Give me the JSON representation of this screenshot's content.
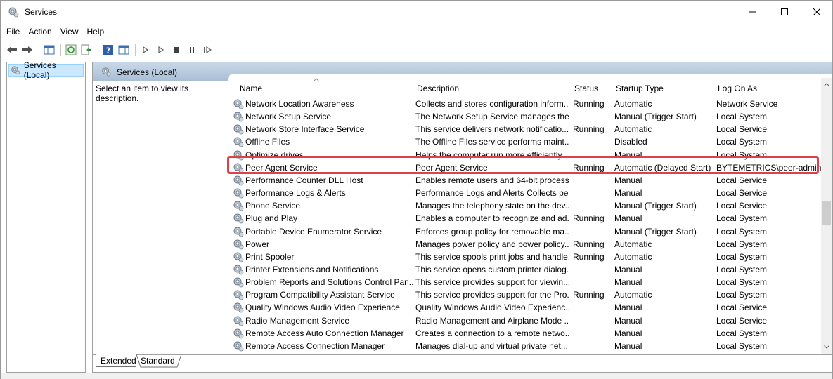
{
  "window": {
    "title": "Services"
  },
  "menu": [
    "File",
    "Action",
    "View",
    "Help"
  ],
  "tree": {
    "selected": "Services (Local)"
  },
  "pane": {
    "title": "Services (Local)",
    "prompt": "Select an item to view its description."
  },
  "columns": {
    "name": "Name",
    "description": "Description",
    "status": "Status",
    "startup": "Startup Type",
    "logon": "Log On As"
  },
  "rows": [
    {
      "name": "Network Location Awareness",
      "description": "Collects and stores configuration inform...",
      "status": "Running",
      "startup": "Automatic",
      "logon": "Network Service"
    },
    {
      "name": "Network Setup Service",
      "description": "The Network Setup Service manages the...",
      "status": "",
      "startup": "Manual (Trigger Start)",
      "logon": "Local System"
    },
    {
      "name": "Network Store Interface Service",
      "description": "This service delivers network notificatio...",
      "status": "Running",
      "startup": "Automatic",
      "logon": "Local Service"
    },
    {
      "name": "Offline Files",
      "description": "The Offline Files service performs maint...",
      "status": "",
      "startup": "Disabled",
      "logon": "Local System"
    },
    {
      "name": "Optimize drives",
      "description": "Helps the computer run more efficiently...",
      "status": "",
      "startup": "Manual",
      "logon": "Local System"
    },
    {
      "name": "Peer Agent Service",
      "description": "Peer Agent Service",
      "status": "Running",
      "startup": "Automatic (Delayed Start)",
      "logon": "BYTEMETRICS\\peer-admin"
    },
    {
      "name": "Performance Counter DLL Host",
      "description": "Enables remote users and 64-bit process...",
      "status": "",
      "startup": "Manual",
      "logon": "Local Service"
    },
    {
      "name": "Performance Logs & Alerts",
      "description": "Performance Logs and Alerts Collects pe...",
      "status": "",
      "startup": "Manual",
      "logon": "Local Service"
    },
    {
      "name": "Phone Service",
      "description": "Manages the telephony state on the dev...",
      "status": "",
      "startup": "Manual (Trigger Start)",
      "logon": "Local Service"
    },
    {
      "name": "Plug and Play",
      "description": "Enables a computer to recognize and ad...",
      "status": "Running",
      "startup": "Manual",
      "logon": "Local System"
    },
    {
      "name": "Portable Device Enumerator Service",
      "description": "Enforces group policy for removable ma...",
      "status": "",
      "startup": "Manual (Trigger Start)",
      "logon": "Local System"
    },
    {
      "name": "Power",
      "description": "Manages power policy and power policy...",
      "status": "Running",
      "startup": "Automatic",
      "logon": "Local System"
    },
    {
      "name": "Print Spooler",
      "description": "This service spools print jobs and handle...",
      "status": "Running",
      "startup": "Automatic",
      "logon": "Local System"
    },
    {
      "name": "Printer Extensions and Notifications",
      "description": "This service opens custom printer dialog...",
      "status": "",
      "startup": "Manual",
      "logon": "Local System"
    },
    {
      "name": "Problem Reports and Solutions Control Pan...",
      "description": "This service provides support for viewin...",
      "status": "",
      "startup": "Manual",
      "logon": "Local System"
    },
    {
      "name": "Program Compatibility Assistant Service",
      "description": "This service provides support for the Pro...",
      "status": "Running",
      "startup": "Automatic",
      "logon": "Local System"
    },
    {
      "name": "Quality Windows Audio Video Experience",
      "description": "Quality Windows Audio Video Experienc...",
      "status": "",
      "startup": "Manual",
      "logon": "Local Service"
    },
    {
      "name": "Radio Management Service",
      "description": "Radio Management and Airplane Mode ...",
      "status": "",
      "startup": "Manual",
      "logon": "Local Service"
    },
    {
      "name": "Remote Access Auto Connection Manager",
      "description": "Creates a connection to a remote netwo...",
      "status": "",
      "startup": "Manual",
      "logon": "Local System"
    },
    {
      "name": "Remote Access Connection Manager",
      "description": "Manages dial-up and virtual private net...",
      "status": "",
      "startup": "Manual",
      "logon": "Local System"
    }
  ],
  "highlighted_row": "Peer Agent Service",
  "highlight_color": "#e0404a",
  "tabs": [
    "Extended",
    "Standard"
  ]
}
